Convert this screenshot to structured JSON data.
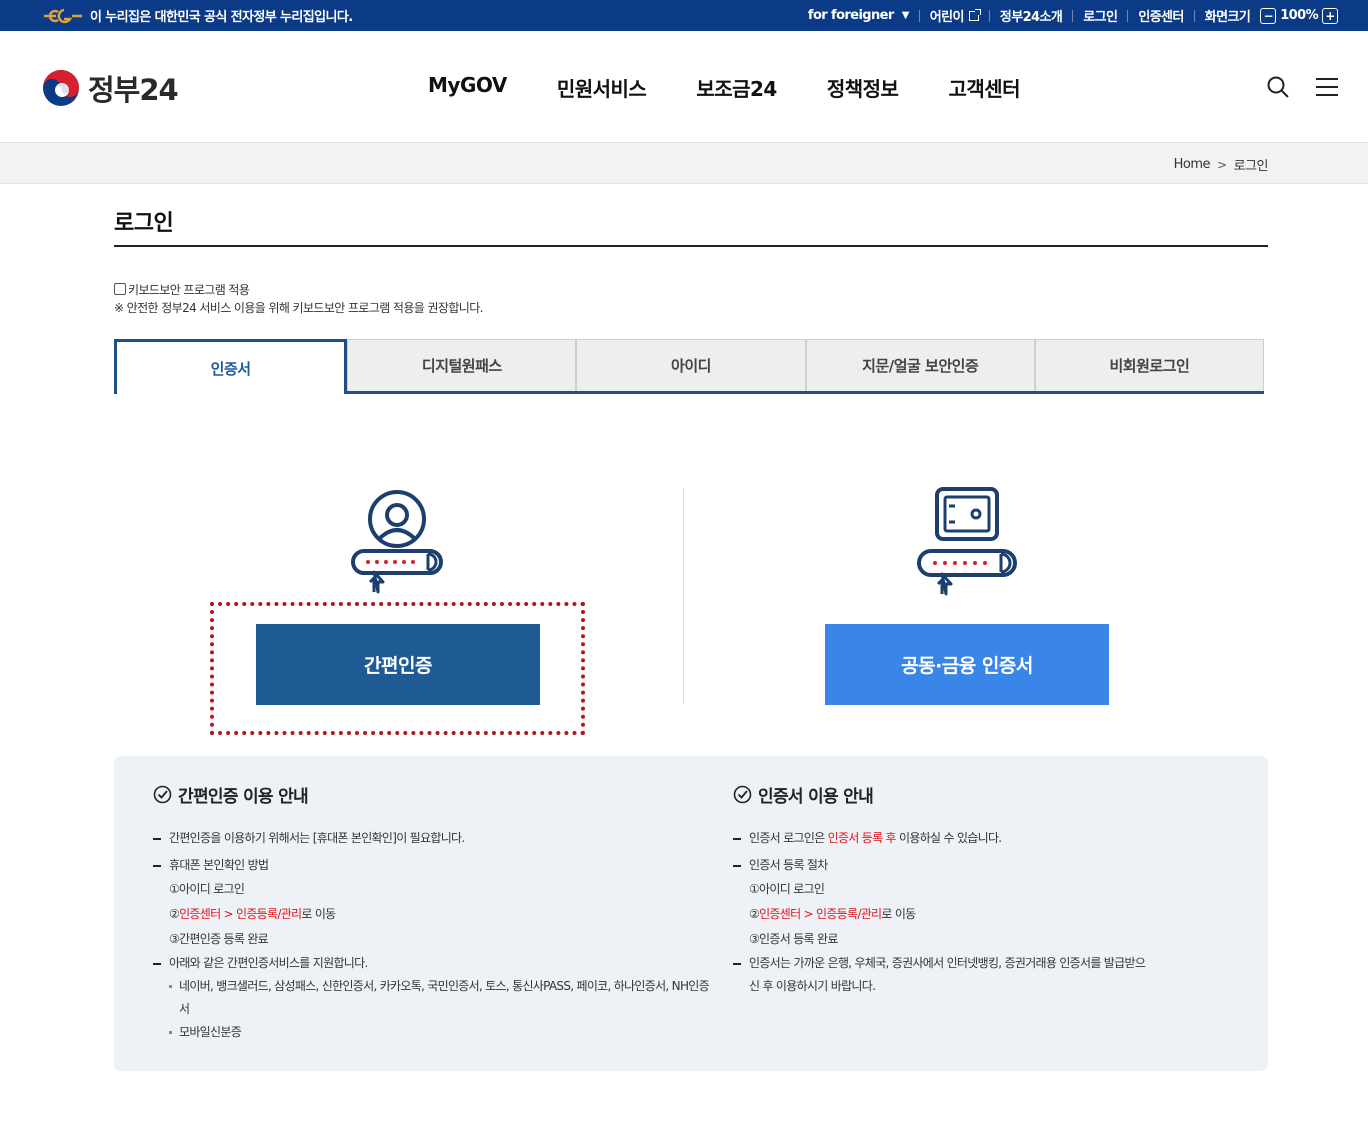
{
  "topbar": {
    "notice": "이 누리집은 대한민국 공식 전자정부 누리집입니다.",
    "utils": {
      "foreigner": "for foreigner",
      "kids": "어린이",
      "about": "정부24소개",
      "login": "로그인",
      "cert_center": "인증센터",
      "screen_size": "화면크기",
      "zoom_minus": "−",
      "zoom_value": "100%",
      "zoom_plus": "+"
    }
  },
  "header": {
    "logo_text": "정부24",
    "nav": [
      "MyGOV",
      "민원서비스",
      "보조금24",
      "정책정보",
      "고객센터"
    ]
  },
  "breadcrumb": {
    "home": "Home",
    "current": "로그인"
  },
  "page_title": "로그인",
  "keyboard": {
    "checkbox_label": "키보드보안 프로그램 적용",
    "note": "※ 안전한 정부24 서비스 이용을 위해 키보드보안 프로그램 적용을 권장합니다."
  },
  "tabs": [
    "인증서",
    "디지털원패스",
    "아이디",
    "지문/얼굴 보안인증",
    "비회원로그인"
  ],
  "buttons": {
    "simple": "간편인증",
    "cert": "공동·금융 인증서"
  },
  "info": {
    "left": {
      "title": "간편인증 이용 안내",
      "l1": "간편인증을 이용하기 위해서는 [휴대폰 본인확인]이 필요합니다.",
      "l2": "휴대폰 본인확인 방법",
      "s1": "①아이디 로그인",
      "s2_pre": "②",
      "s2_red": "인증센터 > 인증등록/관리",
      "s2_post": "로 이동",
      "s3": "③간편인증 등록 완료",
      "l3": "아래와 같은 간편인증서비스를 지원합니다.",
      "d1": "네이버, 뱅크샐러드, 삼성패스, 신한인증서, 카카오톡, 국민인증서, 토스, 통신사PASS, 페이코, 하나인증서, NH인증서",
      "d2": "모바일신분증"
    },
    "right": {
      "title": "인증서 이용 안내",
      "l1_pre": "인증서 로그인은 ",
      "l1_red": "인증서 등록 후",
      "l1_post": " 이용하실 수 있습니다.",
      "l2": "인증서 등록 절차",
      "s1": "①아이디 로그인",
      "s2_pre": "②",
      "s2_red": "인증센터 > 인증등록/관리",
      "s2_post": "로 이동",
      "s3": "③인증서 등록 완료",
      "l3": "인증서는 가까운 은행, 우체국, 증권사에서 인터넷뱅킹, 증권거래용 인증서를 발급받으신 후 이용하시기 바랍니다."
    }
  },
  "colors": {
    "navy": "#0b3a86",
    "primary": "#1e5b94",
    "cert_blue": "#3a86e8",
    "highlight": "#b0161c",
    "red": "#e0121b"
  }
}
